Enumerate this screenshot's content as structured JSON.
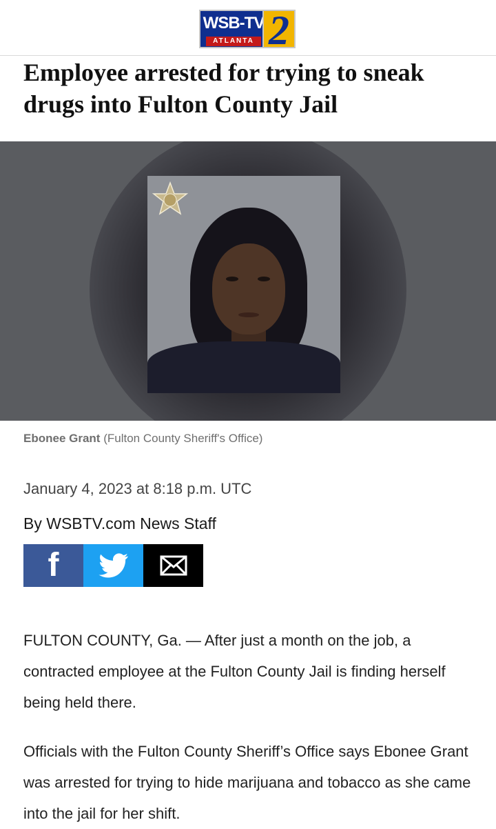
{
  "header": {
    "logo_text": "WSB-TV",
    "logo_city": "ATLANTA",
    "logo_channel": "2"
  },
  "article": {
    "headline": "Employee arrested for trying to sneak drugs into Fulton County Jail",
    "image_caption_name": "Ebonee Grant",
    "image_caption_credit": "(Fulton County Sheriff's Office)",
    "date": "January 4, 2023 at 8:18 p.m. UTC",
    "byline": "By WSBTV.com News Staff",
    "share": {
      "facebook_glyph": "f",
      "facebook_icon": "facebook-icon",
      "twitter_icon": "twitter-icon",
      "email_icon": "email-icon"
    },
    "paragraphs": [
      "FULTON COUNTY, Ga. — After just a month on the job, a contracted employee at the Fulton County Jail is finding herself being held there.",
      "Officials with the Fulton County Sheriff’s Office says Ebonee Grant was arrested for trying to hide marijuana and tobacco as she came into the jail for her shift."
    ]
  },
  "colors": {
    "facebook": "#3b5998",
    "twitter": "#1da1f2",
    "email": "#000000",
    "logo_blue": "#0f2f8f",
    "logo_gold": "#f2b500"
  }
}
